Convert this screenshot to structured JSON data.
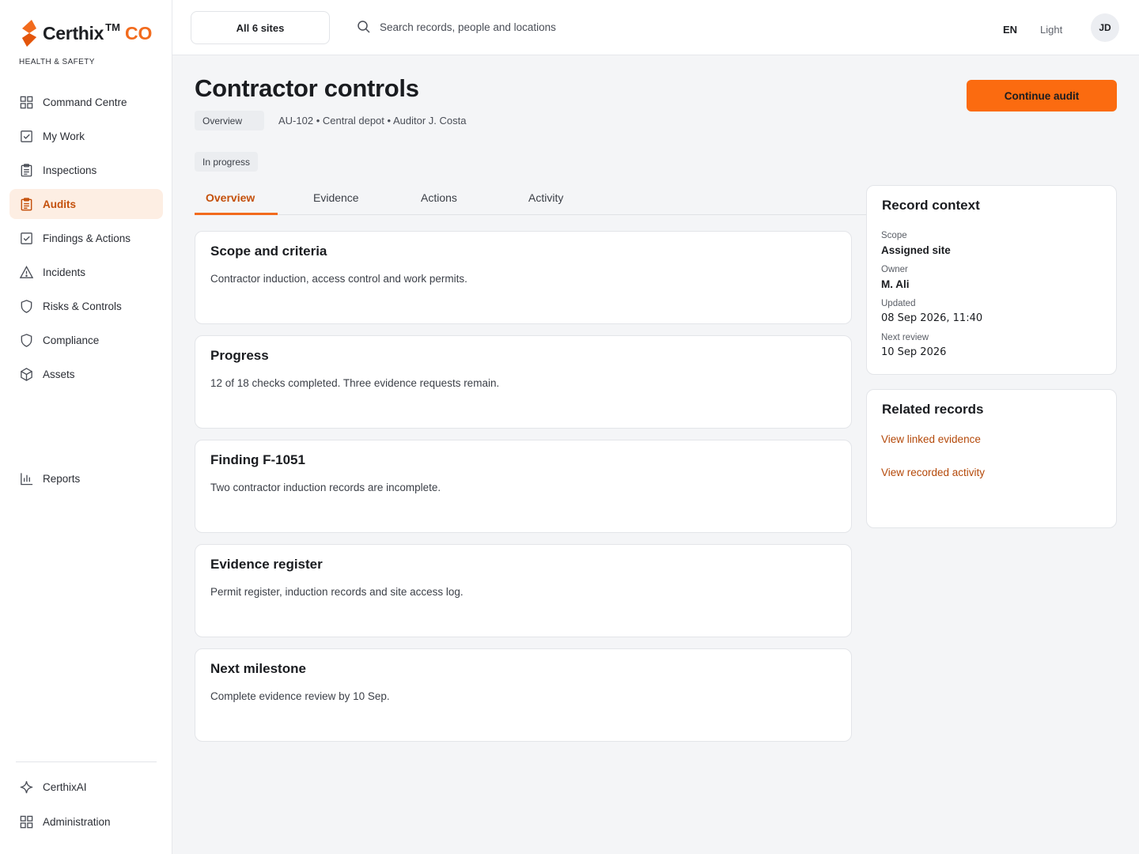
{
  "brand": {
    "name": "Certhix",
    "tm": "TM",
    "suffix": "CO",
    "subtitle": "HEALTH & SAFETY",
    "accent_color": "#f26b1d"
  },
  "sidebar": {
    "items": [
      {
        "label": "Command Centre",
        "icon": "grid-icon"
      },
      {
        "label": "My Work",
        "icon": "check-square-icon"
      },
      {
        "label": "Inspections",
        "icon": "clipboard-icon"
      },
      {
        "label": "Audits",
        "icon": "clipboard-icon",
        "active": true
      },
      {
        "label": "Findings & Actions",
        "icon": "check-square-icon"
      },
      {
        "label": "Incidents",
        "icon": "warning-triangle-icon"
      },
      {
        "label": "Risks & Controls",
        "icon": "shield-icon"
      },
      {
        "label": "Compliance",
        "icon": "shield-icon"
      },
      {
        "label": "Assets",
        "icon": "cube-icon"
      }
    ],
    "reports": {
      "label": "Reports",
      "icon": "bar-chart-icon"
    },
    "bottom": [
      {
        "label": "CerthixAI",
        "icon": "sparkle-icon"
      },
      {
        "label": "Administration",
        "icon": "grid-icon"
      }
    ]
  },
  "topbar": {
    "site_selector": "All 6 sites",
    "search_placeholder": "Search records, people and locations",
    "language": "EN",
    "theme": "Light",
    "avatar_initials": "JD"
  },
  "header": {
    "title": "Contractor controls",
    "breadcrumb_chip": "Overview",
    "meta": "AU-102 • Central depot • Auditor J. Costa",
    "status": "In progress",
    "primary_action": "Continue audit"
  },
  "tabs": [
    "Overview",
    "Evidence",
    "Actions",
    "Activity"
  ],
  "cards": [
    {
      "title": "Scope and criteria",
      "body": "Contractor induction, access control and work permits."
    },
    {
      "title": "Progress",
      "body": "12 of 18 checks completed. Three evidence requests remain."
    },
    {
      "title": "Finding F-1051",
      "body": "Two contractor induction records are incomplete."
    },
    {
      "title": "Evidence register",
      "body": "Permit register, induction records and site access log."
    },
    {
      "title": "Next milestone",
      "body": "Complete evidence review by 10 Sep."
    }
  ],
  "record_context": {
    "title": "Record context",
    "fields": [
      {
        "label": "Scope",
        "value": "Assigned site"
      },
      {
        "label": "Owner",
        "value": "M. Ali"
      },
      {
        "label": "Updated",
        "value": "08 Sep 2026, 11:40"
      },
      {
        "label": "Next review",
        "value": "10 Sep 2026"
      }
    ]
  },
  "related_records": {
    "title": "Related records",
    "links": [
      "View linked evidence",
      "View recorded activity"
    ]
  }
}
